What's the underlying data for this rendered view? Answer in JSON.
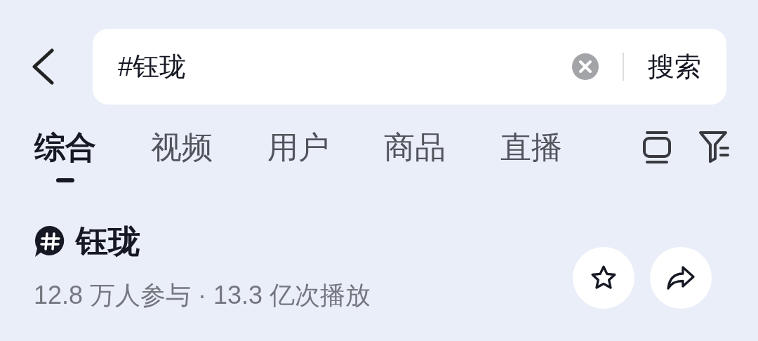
{
  "search": {
    "value": "#钰珑",
    "action": "搜索"
  },
  "tabs": [
    {
      "label": "综合",
      "selected": true
    },
    {
      "label": "视频",
      "selected": false
    },
    {
      "label": "用户",
      "selected": false
    },
    {
      "label": "商品",
      "selected": false
    },
    {
      "label": "直播",
      "selected": false
    }
  ],
  "topic": {
    "title": "钰珑",
    "stats": "12.8 万人参与 · 13.3 亿次播放"
  }
}
